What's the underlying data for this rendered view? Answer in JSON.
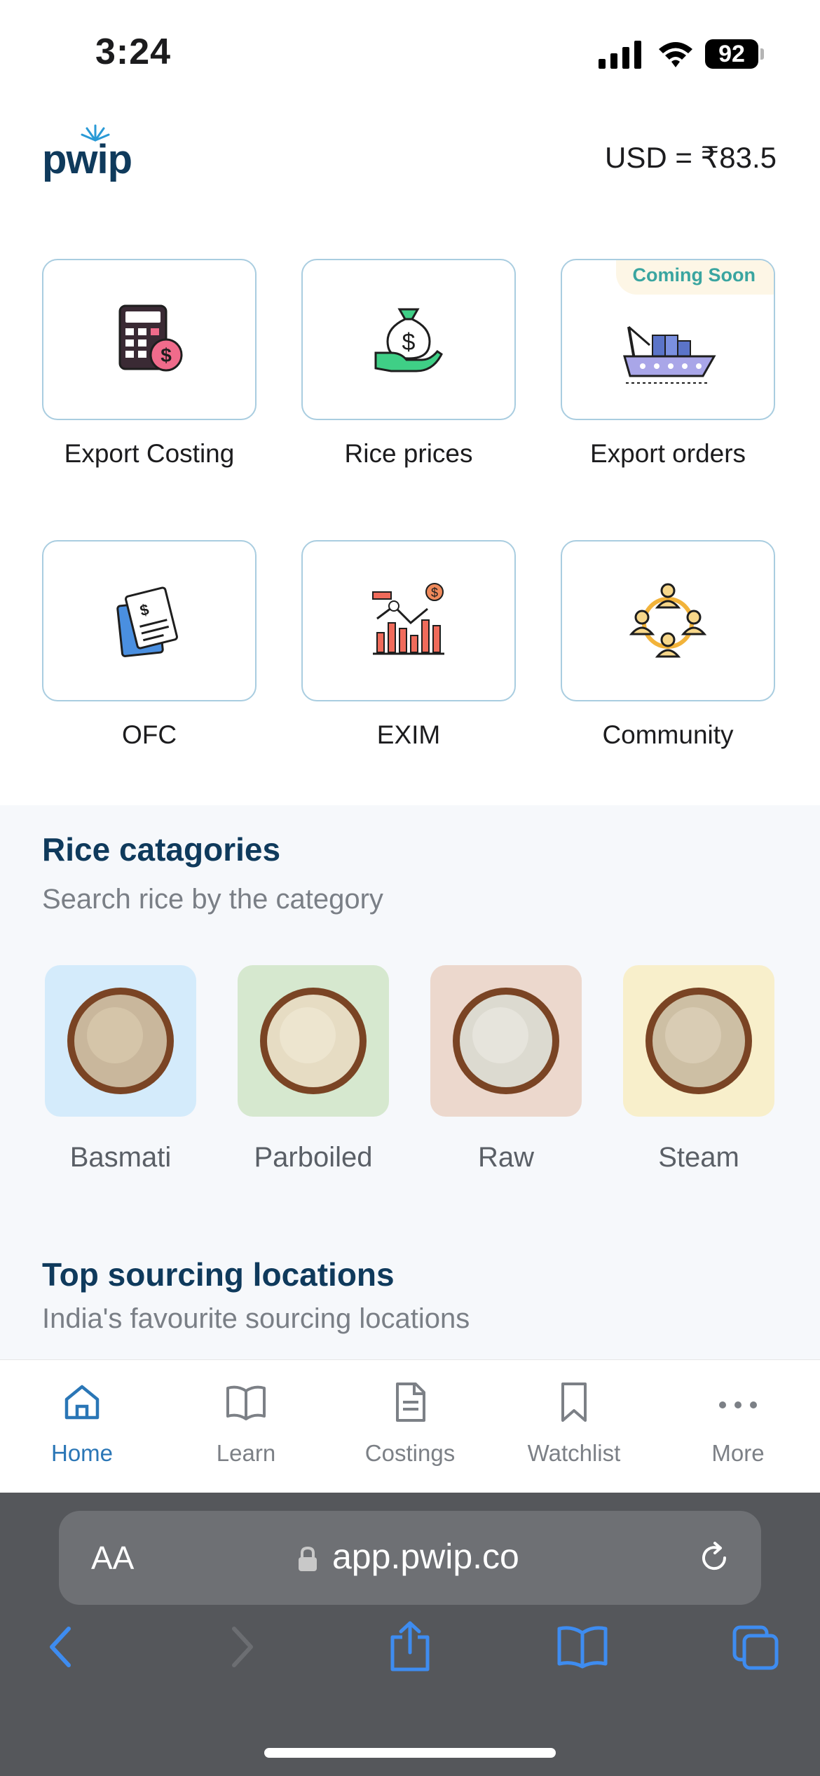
{
  "status_bar": {
    "time": "3:24",
    "battery": "92"
  },
  "header": {
    "logo": "pwip",
    "currency_rate": "USD = ₹83.5"
  },
  "tiles": [
    {
      "label": "Export Costing",
      "icon": "calculator-icon"
    },
    {
      "label": "Rice prices",
      "icon": "money-bag-hand-icon"
    },
    {
      "label": "Export orders",
      "icon": "cargo-ship-icon",
      "badge": "Coming Soon"
    },
    {
      "label": "OFC",
      "icon": "invoice-documents-icon"
    },
    {
      "label": "EXIM",
      "icon": "bar-chart-dollar-icon"
    },
    {
      "label": "Community",
      "icon": "community-people-icon"
    }
  ],
  "categories_section": {
    "title": "Rice catagories",
    "subtitle": "Search rice by the category",
    "items": [
      {
        "label": "Basmati",
        "bg": "#d4ebfb"
      },
      {
        "label": "Parboiled",
        "bg": "#d6e8cf"
      },
      {
        "label": "Raw",
        "bg": "#ecd8cd"
      },
      {
        "label": "Steam",
        "bg": "#f8efcb"
      }
    ]
  },
  "sourcing_section": {
    "title": "Top sourcing locations",
    "subtitle": "India's favourite sourcing locations"
  },
  "tab_bar": {
    "items": [
      {
        "label": "Home",
        "icon": "home-icon",
        "active": true
      },
      {
        "label": "Learn",
        "icon": "book-icon"
      },
      {
        "label": "Costings",
        "icon": "document-icon"
      },
      {
        "label": "Watchlist",
        "icon": "bookmark-icon"
      },
      {
        "label": "More",
        "icon": "more-dots-icon"
      }
    ]
  },
  "browser": {
    "text_size_label": "AA",
    "url": "app.pwip.co"
  },
  "colors": {
    "accent": "#2a76b6",
    "title": "#0f3a5c",
    "tile_border": "#a9cde0"
  }
}
